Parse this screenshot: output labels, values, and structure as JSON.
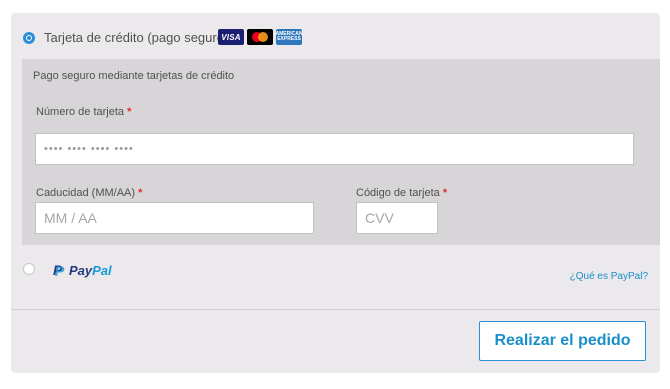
{
  "payment_methods": {
    "credit_card": {
      "label": "Tarjeta de crédito (pago seguro)",
      "selected": true,
      "card_logos": [
        {
          "name": "visa",
          "text": "VISA",
          "color": "#1a1f71"
        },
        {
          "name": "mastercard",
          "text": "MasterCard",
          "color": "#eb001b"
        },
        {
          "name": "american-express",
          "text": "AMERICAN EXPRESS",
          "color": "#2e77bb"
        }
      ],
      "form": {
        "title": "Pago seguro mediante tarjetas de crédito",
        "card_number": {
          "label": "Número de tarjeta",
          "required_mark": "*",
          "placeholder": "•••• •••• •••• ••••"
        },
        "expiry": {
          "label": "Caducidad (MM/AA)",
          "required_mark": "*",
          "placeholder": "MM / AA"
        },
        "cvv": {
          "label": "Código de tarjeta",
          "required_mark": "*",
          "placeholder": "CVV"
        }
      }
    },
    "paypal": {
      "logo_text_pay": "Pay",
      "logo_text_pal": "Pal",
      "selected": false,
      "help_link": "¿Qué es PayPal?"
    }
  },
  "submit_button": {
    "label": "Realizar el pedido"
  },
  "colors": {
    "accent": "#2a8fd6",
    "required": "#e02b27",
    "panel_bg": "#ebe9eb",
    "form_bg": "#d7d5d7"
  }
}
